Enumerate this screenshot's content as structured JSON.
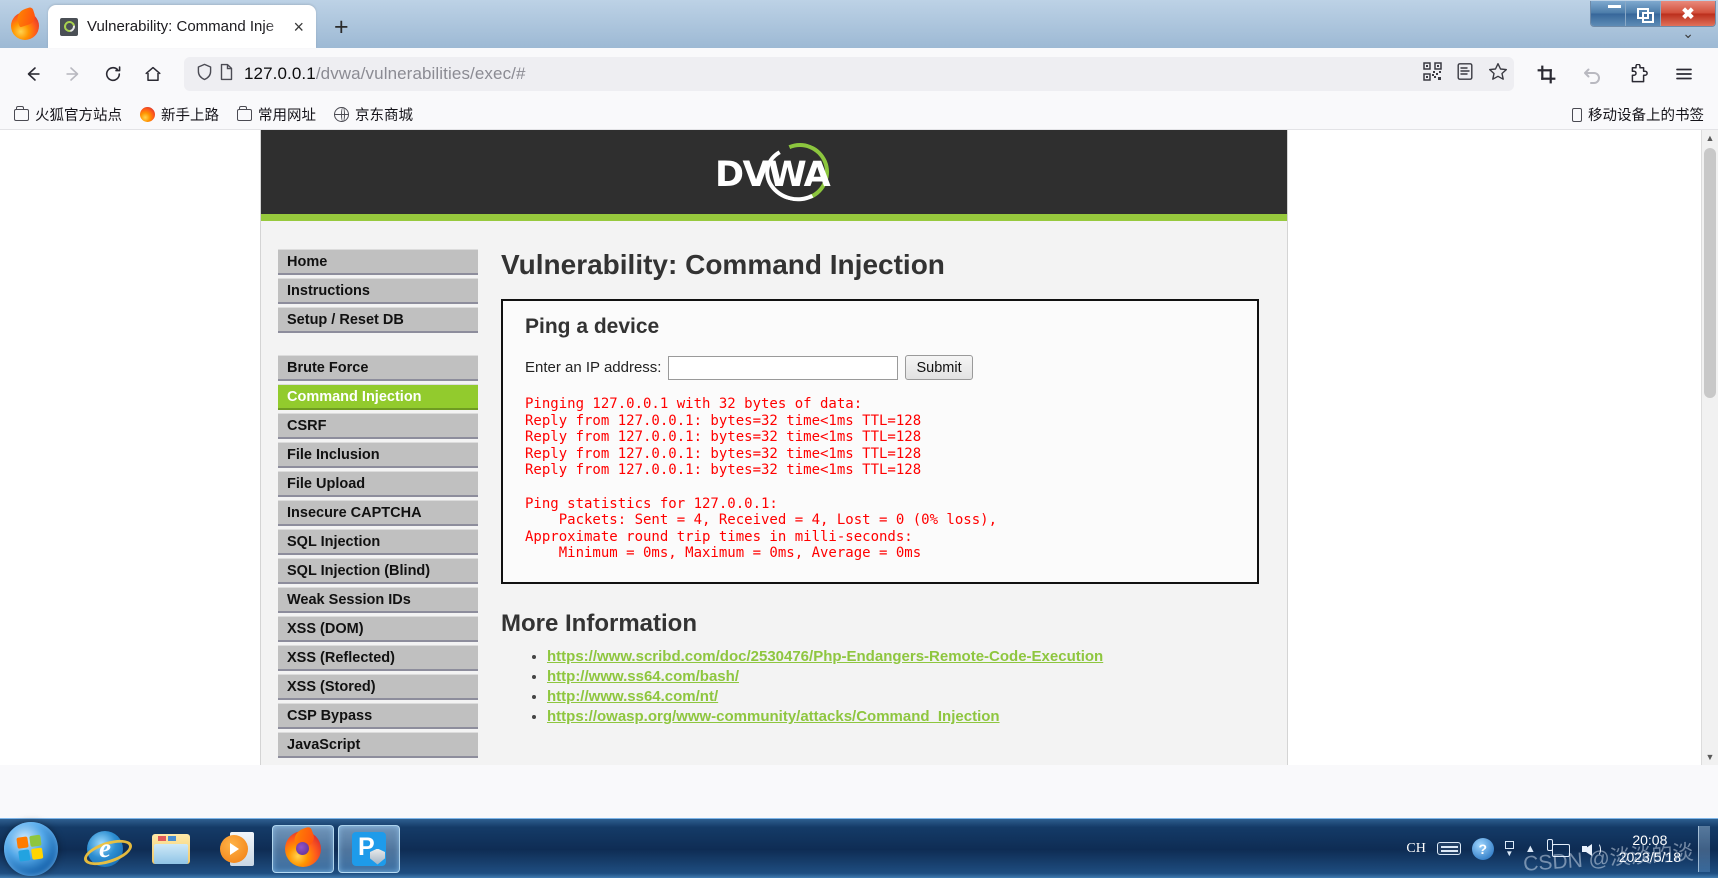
{
  "window": {
    "controls": {
      "minimize": "Minimize",
      "maximize": "Restore",
      "close": "Close"
    }
  },
  "browser": {
    "tab": {
      "title": "Vulnerability: Command Inje",
      "close_label": "×",
      "favicon": "dvwa-favicon"
    },
    "new_tab_label": "+",
    "tab_list_chevron": "⌄",
    "nav": {
      "back": "Back",
      "forward": "Forward",
      "reload": "Reload",
      "home": "Home"
    },
    "urlbar": {
      "value_host": "127.0.0.1",
      "value_path": "/dvwa/vulnerabilities/exec/#",
      "full_url": "127.0.0.1/dvwa/vulnerabilities/exec/#",
      "shield_icon": "shield-icon",
      "page_icon": "page-icon",
      "qr_icon": "qr-code-icon",
      "reader_icon": "reader-view-icon",
      "bookmark_icon": "star-icon"
    },
    "toolbar_end": {
      "screenshot": "screenshot-icon",
      "undo": "undo-icon",
      "extensions": "puzzle-icon",
      "menu": "hamburger-menu-icon"
    },
    "bookmarks": [
      {
        "label": "火狐官方站点",
        "icon": "folder"
      },
      {
        "label": "新手上路",
        "icon": "firefox"
      },
      {
        "label": "常用网址",
        "icon": "folder"
      },
      {
        "label": "京东商城",
        "icon": "globe"
      }
    ],
    "bookmarks_right": {
      "label": "移动设备上的书签",
      "icon": "mobile"
    }
  },
  "dvwa": {
    "logo_text": "DVWA",
    "nav_primary": [
      {
        "label": "Home",
        "active": false
      },
      {
        "label": "Instructions",
        "active": false
      },
      {
        "label": "Setup / Reset DB",
        "active": false
      }
    ],
    "nav_vulns": [
      {
        "label": "Brute Force",
        "active": false
      },
      {
        "label": "Command Injection",
        "active": true
      },
      {
        "label": "CSRF",
        "active": false
      },
      {
        "label": "File Inclusion",
        "active": false
      },
      {
        "label": "File Upload",
        "active": false
      },
      {
        "label": "Insecure CAPTCHA",
        "active": false
      },
      {
        "label": "SQL Injection",
        "active": false
      },
      {
        "label": "SQL Injection (Blind)",
        "active": false
      },
      {
        "label": "Weak Session IDs",
        "active": false
      },
      {
        "label": "XSS (DOM)",
        "active": false
      },
      {
        "label": "XSS (Reflected)",
        "active": false
      },
      {
        "label": "XSS (Stored)",
        "active": false
      },
      {
        "label": "CSP Bypass",
        "active": false
      },
      {
        "label": "JavaScript",
        "active": false
      }
    ],
    "page_title": "Vulnerability: Command Injection",
    "panel": {
      "heading": "Ping a device",
      "field_label": "Enter an IP address:",
      "input_value": "",
      "input_placeholder": "",
      "submit_label": "Submit"
    },
    "ping_output": "Pinging 127.0.0.1 with 32 bytes of data:\nReply from 127.0.0.1: bytes=32 time<1ms TTL=128\nReply from 127.0.0.1: bytes=32 time<1ms TTL=128\nReply from 127.0.0.1: bytes=32 time<1ms TTL=128\nReply from 127.0.0.1: bytes=32 time<1ms TTL=128\n\nPing statistics for 127.0.0.1:\n    Packets: Sent = 4, Received = 4, Lost = 0 (0% loss),\nApproximate round trip times in milli-seconds:\n    Minimum = 0ms, Maximum = 0ms, Average = 0ms",
    "more_info_heading": "More Information",
    "links": [
      "https://www.scribd.com/doc/2530476/Php-Endangers-Remote-Code-Execution",
      "http://www.ss64.com/bash/",
      "http://www.ss64.com/nt/",
      "https://owasp.org/www-community/attacks/Command_Injection"
    ],
    "colors": {
      "accent_green": "#97c93d",
      "active_item": "#92cb2d",
      "header_dark": "#2f2f2f",
      "output_red": "#ff0000",
      "link_green": "#8ec63f"
    }
  },
  "scrollbar": {
    "up": "▲",
    "down": "▼"
  },
  "taskbar": {
    "start_label": "Start",
    "items": [
      {
        "name": "internet-explorer",
        "label": "Internet Explorer",
        "active": false
      },
      {
        "name": "file-explorer",
        "label": "Windows Explorer",
        "active": false
      },
      {
        "name": "media-player",
        "label": "Windows Media Player",
        "active": false
      },
      {
        "name": "firefox",
        "label": "Mozilla Firefox",
        "active": true
      },
      {
        "name": "phpstudy",
        "label": "phpStudy",
        "active": true
      }
    ],
    "tray": {
      "input_method": "CH",
      "keyboard": "keyboard-icon",
      "help": "help-icon",
      "expand": "show-hidden-icons",
      "network": "network-icon",
      "volume": "volume-icon",
      "time": "20:08",
      "date": "2023/5/18"
    },
    "watermark": "CSDN @淡淡的淡"
  }
}
